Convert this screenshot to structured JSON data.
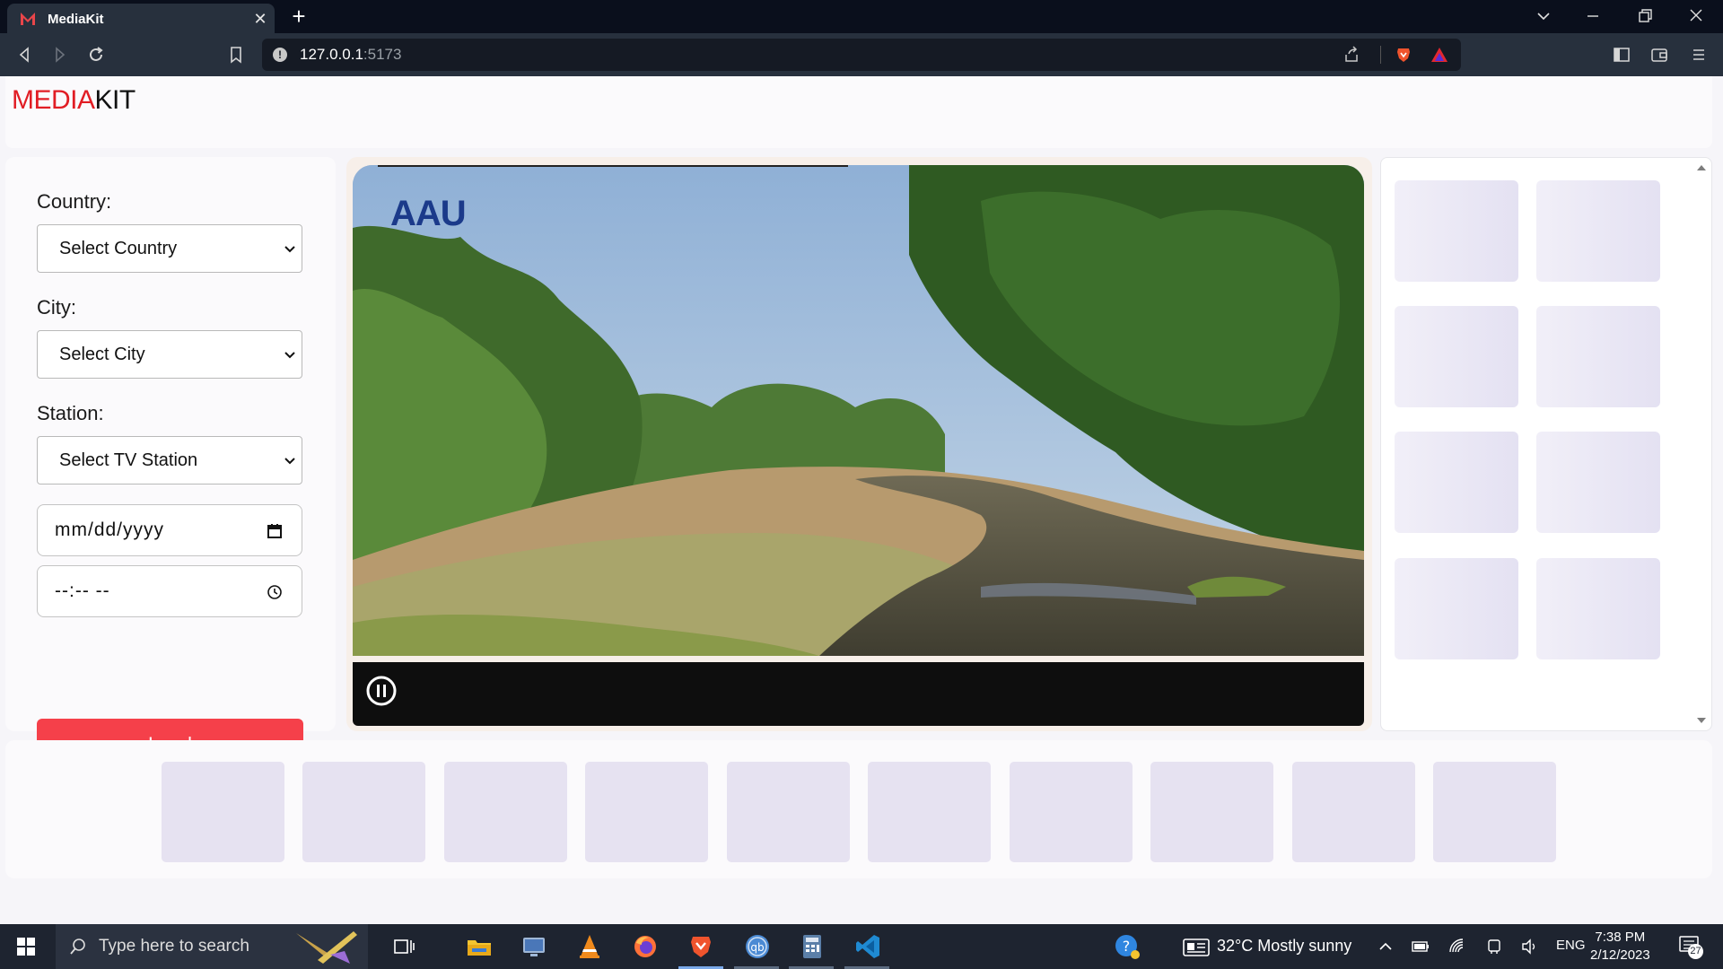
{
  "browser": {
    "tab_title": "MediaKit",
    "url_host": "127.0.0.1",
    "url_port": ":5173",
    "new_tab": "+",
    "close_tab": "✕"
  },
  "app": {
    "logo_part1": "MEDIA",
    "logo_part2": "KIT",
    "brand_red": "#e11d24"
  },
  "filters": {
    "country_label": "Country:",
    "country_value": "Select Country",
    "city_label": "City:",
    "city_value": "Select City",
    "station_label": "Station:",
    "station_value": "Select TV Station",
    "date_placeholder": "mm/dd/yyyy",
    "time_placeholder": "--:-- --",
    "load_label": "Load",
    "load_color": "#f5404a"
  },
  "player": {
    "channel_logo": "AAU",
    "state": "playing",
    "pause_icon": "pause-icon"
  },
  "side_thumbnails": {
    "count": 8
  },
  "bottom_thumbnails": {
    "count": 10
  },
  "taskbar": {
    "search_placeholder": "Type here to search",
    "weather": "32°C  Mostly sunny",
    "language": "ENG",
    "time": "7:38 PM",
    "date": "2/12/2023",
    "notifications": "27"
  }
}
